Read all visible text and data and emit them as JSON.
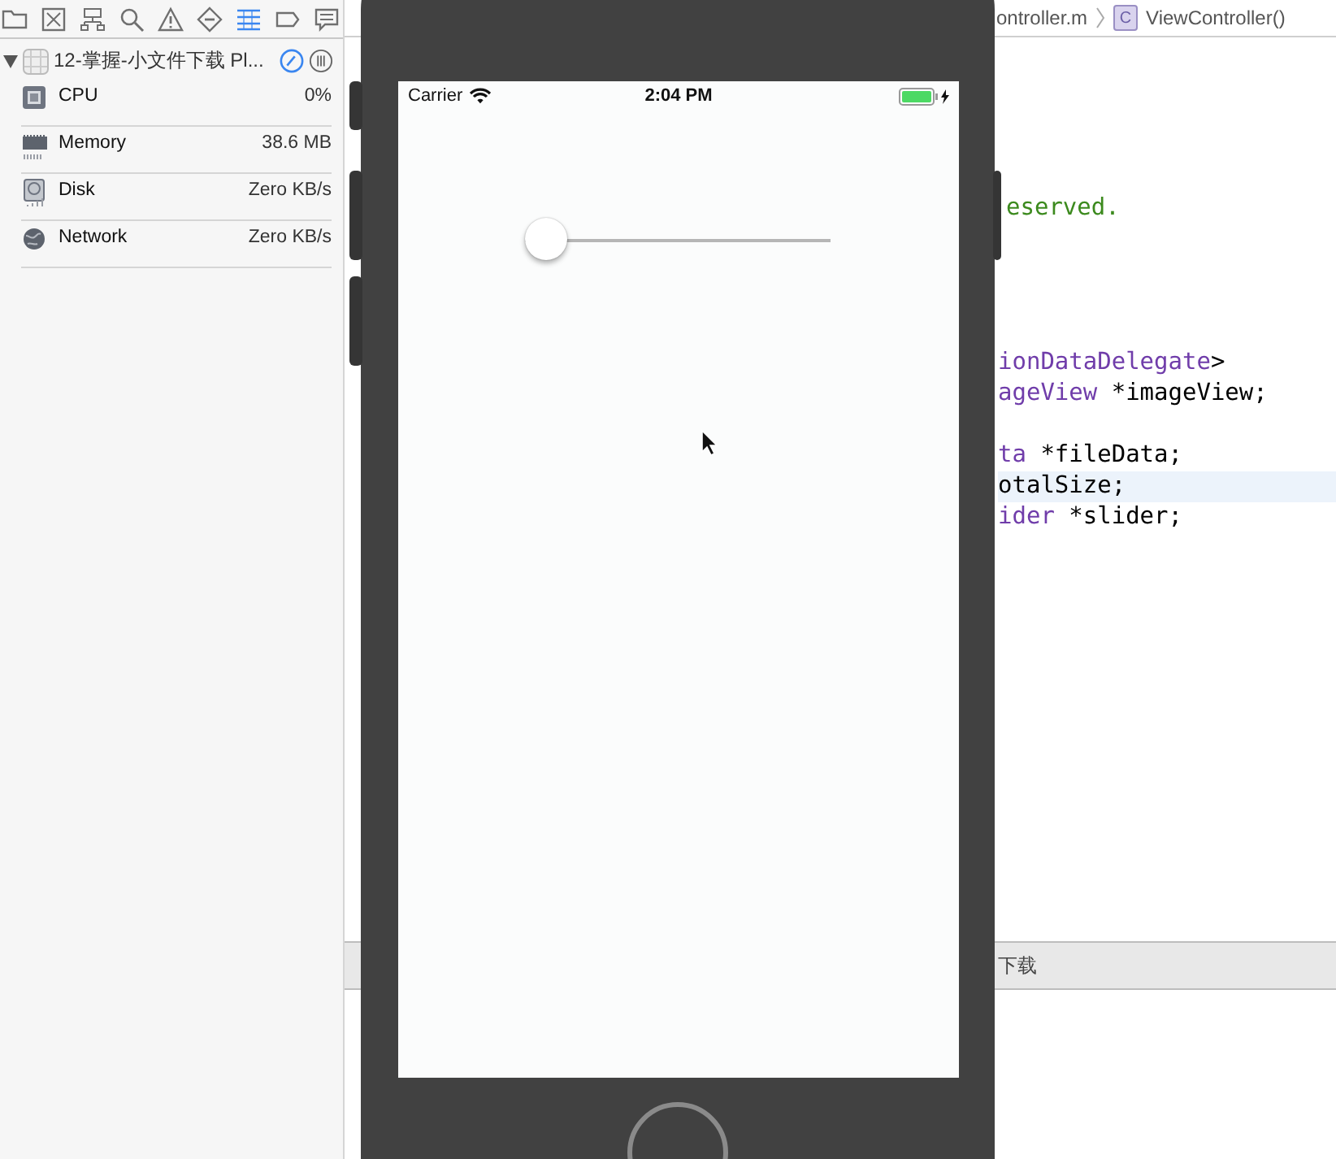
{
  "navigator": {
    "tabs": [
      {
        "kind": "folder",
        "selected": false
      },
      {
        "kind": "symbol",
        "selected": false
      },
      {
        "kind": "hierarchy",
        "selected": false
      },
      {
        "kind": "search",
        "selected": false
      },
      {
        "kind": "warning",
        "selected": false
      },
      {
        "kind": "test",
        "selected": false
      },
      {
        "kind": "debug",
        "selected": true
      },
      {
        "kind": "breakpoint",
        "selected": false
      },
      {
        "kind": "report",
        "selected": false
      }
    ],
    "process": {
      "title": "12-掌握-小文件下载 Pl...",
      "expanded": true
    },
    "gauges": [
      {
        "kind": "cpu",
        "label": "CPU",
        "value": "0%"
      },
      {
        "kind": "memory",
        "label": "Memory",
        "value": "38.6 MB"
      },
      {
        "kind": "disk",
        "label": "Disk",
        "value": "Zero KB/s"
      },
      {
        "kind": "network",
        "label": "Network",
        "value": "Zero KB/s"
      }
    ]
  },
  "editor": {
    "breadcrumb": {
      "file": "ontroller.m",
      "badge": "C",
      "symbol": "ViewController()"
    },
    "code_blocks": [
      [
        {
          "highlighted": false,
          "segments": [
            {
              "kind": "comment",
              "text": "eserved."
            }
          ]
        }
      ],
      [
        {
          "highlighted": false,
          "segments": [
            {
              "kind": "type",
              "text": "ionDataDelegate"
            },
            {
              "kind": "plain",
              "text": ">"
            }
          ]
        },
        {
          "highlighted": false,
          "segments": [
            {
              "kind": "type",
              "text": "ageView"
            },
            {
              "kind": "plain",
              "text": " *imageView;"
            }
          ]
        }
      ],
      [
        {
          "highlighted": false,
          "segments": [
            {
              "kind": "type",
              "text": "ta"
            },
            {
              "kind": "plain",
              "text": " *fileData;"
            }
          ]
        },
        {
          "highlighted": true,
          "segments": [
            {
              "kind": "plain",
              "text": "otalSize;"
            }
          ]
        },
        {
          "highlighted": false,
          "segments": [
            {
              "kind": "type",
              "text": "ider"
            },
            {
              "kind": "plain",
              "text": " *slider;"
            }
          ]
        }
      ]
    ],
    "debug_bar": {
      "text": "下载"
    }
  },
  "simulator": {
    "status_bar": {
      "carrier": "Carrier",
      "time": "2:04 PM",
      "charging": true
    },
    "slider": {
      "level": 0
    }
  }
}
